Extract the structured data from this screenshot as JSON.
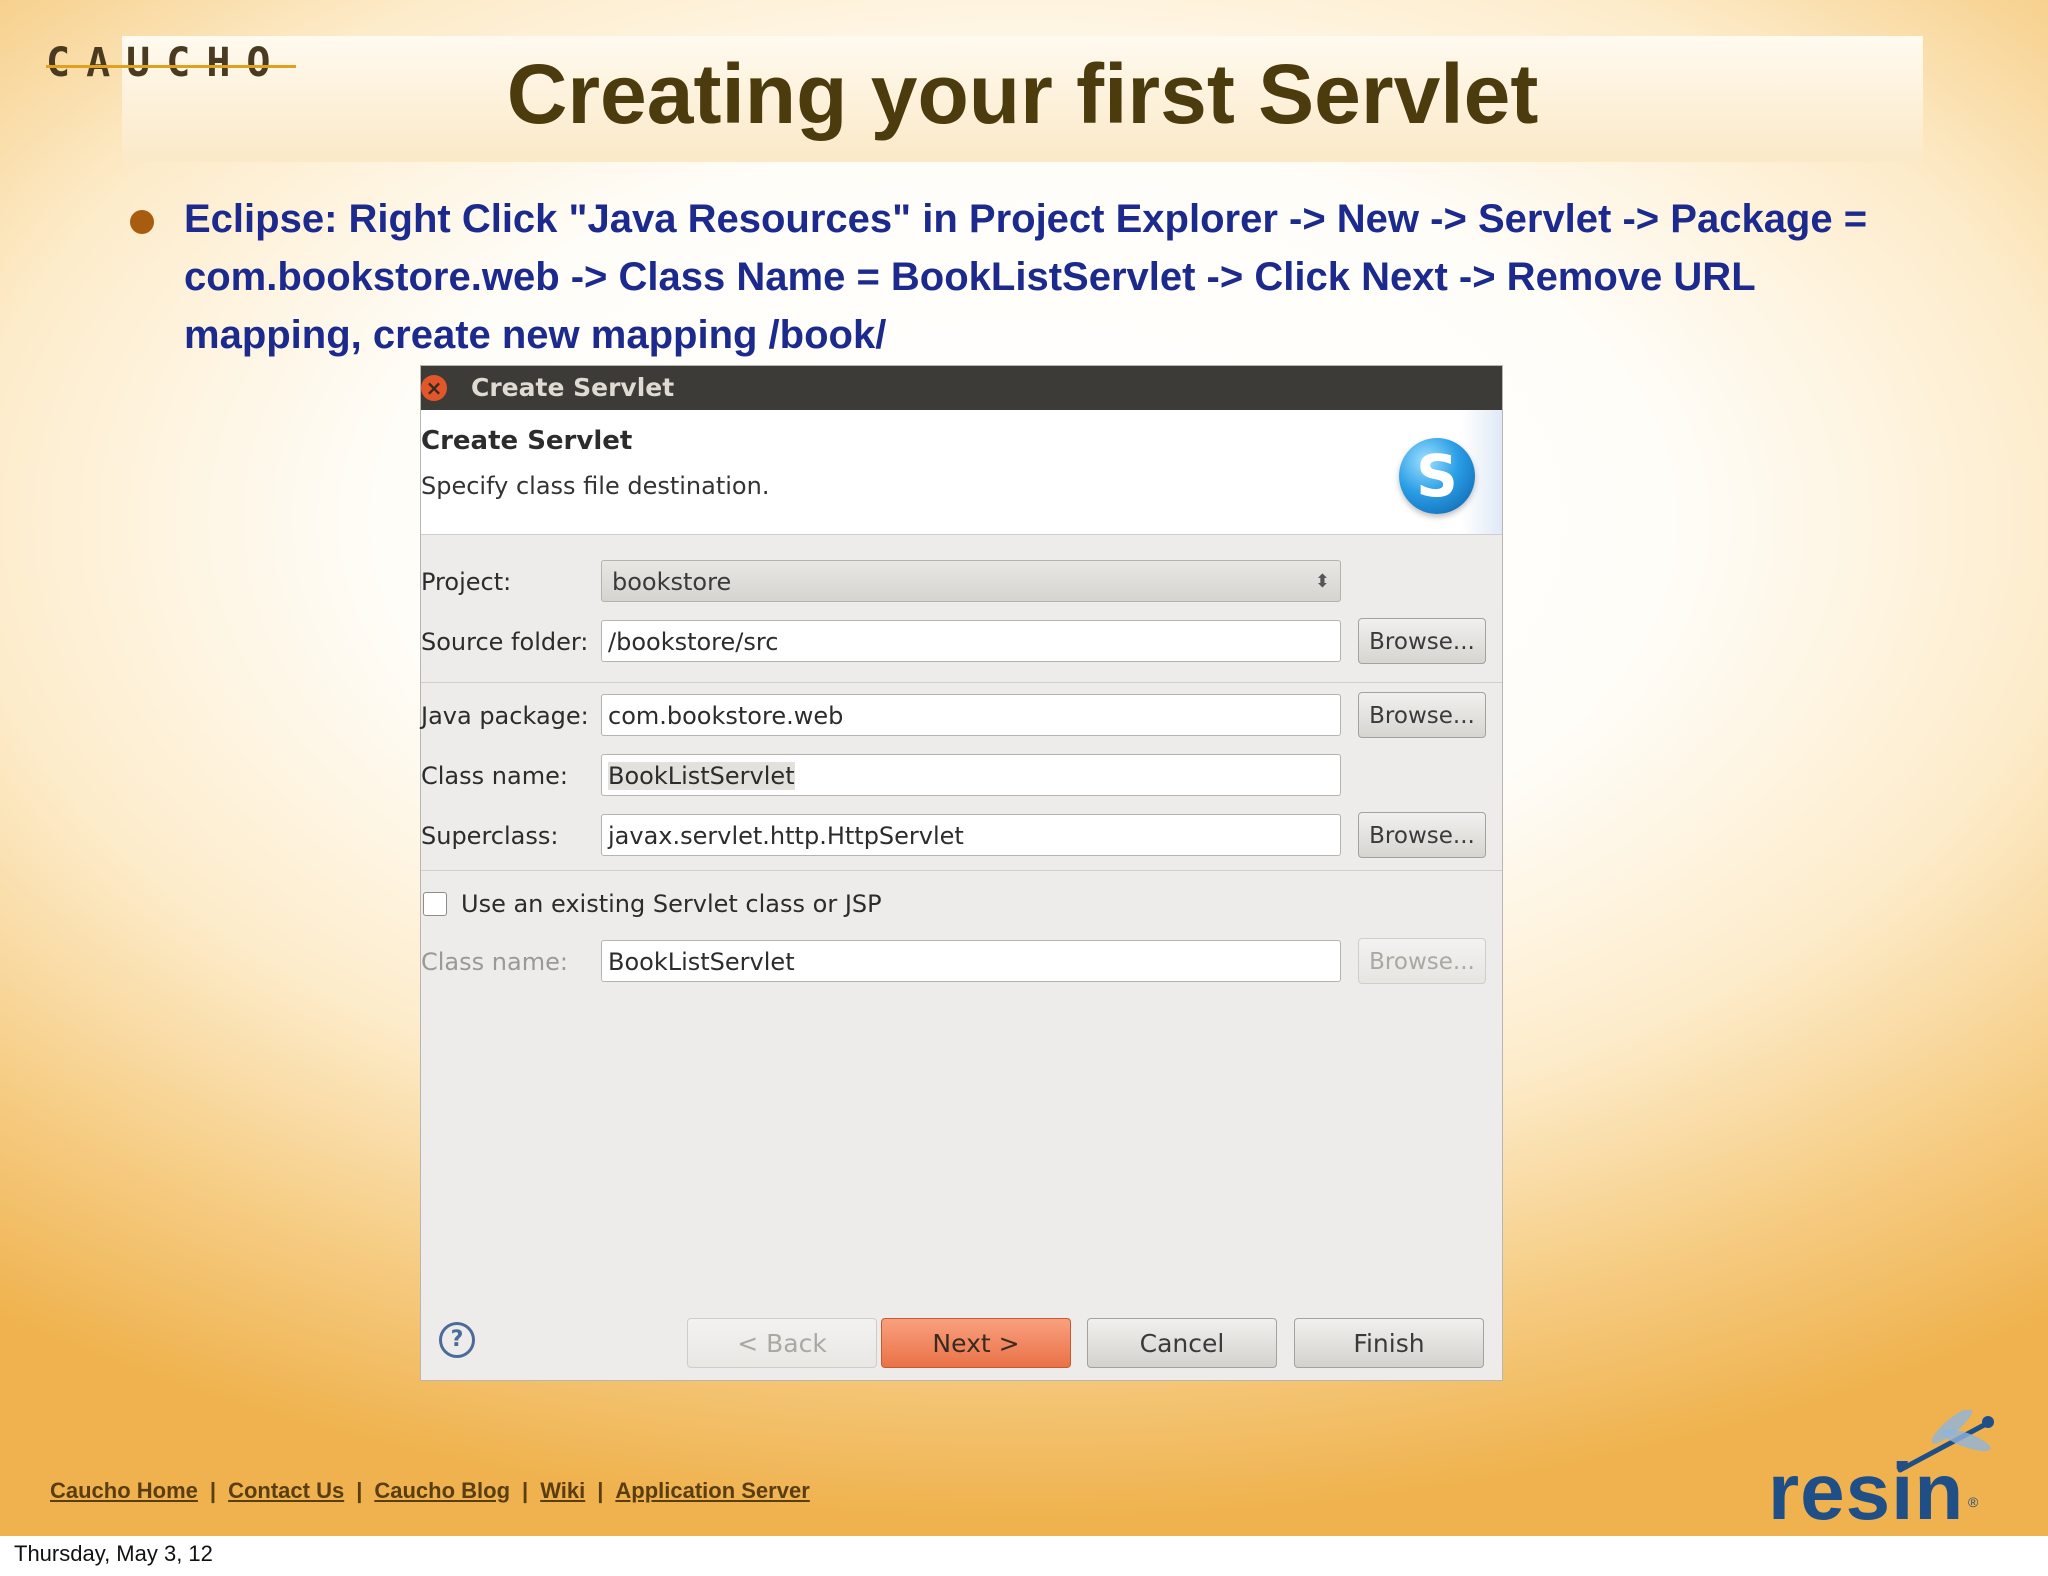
{
  "slide": {
    "logo": "CAUCHO",
    "title": "Creating your first Servlet",
    "bullet": "Eclipse: Right Click \"Java Resources\" in Project Explorer -> New -> Servlet -> Package = com.bookstore.web -> Class Name = BookListServlet -> Click Next -> Remove URL mapping, create new mapping /book/"
  },
  "dialog": {
    "window_title": "Create Servlet",
    "header_title": "Create Servlet",
    "header_subtitle": "Specify class file destination.",
    "icon_glyph": "S",
    "fields": {
      "project_label": "Project:",
      "project_value": "bookstore",
      "source_folder_label": "Source folder:",
      "source_folder_value": "/bookstore/src",
      "java_package_label": "Java package:",
      "java_package_value": "com.bookstore.web",
      "class_name_label": "Class name:",
      "class_name_value": "BookListServlet",
      "superclass_label": "Superclass:",
      "superclass_value": "javax.servlet.http.HttpServlet",
      "existing_checkbox_label": "Use an existing Servlet class or JSP",
      "existing_class_label": "Class name:",
      "existing_class_value": "BookListServlet"
    },
    "browse_label": "Browse...",
    "buttons": {
      "back": "< Back",
      "next": "Next >",
      "cancel": "Cancel",
      "finish": "Finish"
    },
    "colors": {
      "titlebar": "#3c3b37",
      "next_button": "#ea7247",
      "close_button": "#e1572a"
    }
  },
  "footer": {
    "links": [
      "Caucho Home",
      "Contact Us",
      "Caucho Blog",
      "Wiki",
      "Application Server"
    ],
    "separator": "|",
    "brand": "resin",
    "date": "Thursday, May 3, 12"
  }
}
